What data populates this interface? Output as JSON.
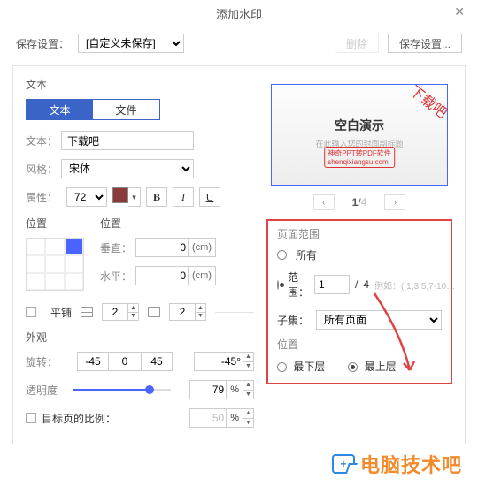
{
  "dialog": {
    "title": "添加水印",
    "close": "✕"
  },
  "saveRow": {
    "label": "保存设置：",
    "preset": "[自定义未保存]",
    "delete": "删除",
    "saveAs": "保存设置..."
  },
  "text": {
    "section": "文本",
    "tabs": {
      "text": "文本",
      "file": "文件"
    },
    "labels": {
      "text": "文本：",
      "style": "风格：",
      "attr": "属性："
    },
    "textValue": "下载吧",
    "styleValue": "宋体",
    "fontSize": "72"
  },
  "fmt": {
    "b": "B",
    "i": "I",
    "u": "U"
  },
  "position": {
    "title": "位置",
    "subTitle": "位置",
    "vert": "垂直：",
    "horiz": "水平：",
    "vertVal": "0",
    "horizVal": "0",
    "unit": "(cm)"
  },
  "tile": {
    "label": "平铺",
    "val1": "2",
    "val2": "2"
  },
  "appearance": {
    "title": "外观",
    "rotate": "旋转：",
    "rotVals": {
      "a": "-45",
      "b": "0",
      "c": "45"
    },
    "rotSel": "-45°",
    "opacity": "透明度",
    "opacityVal": "79",
    "target": "目标页的比例：",
    "targetVal": "50",
    "pct": "%"
  },
  "preview": {
    "corner": "下载吧",
    "title": "空白演示",
    "sub": "在此输入您的封面副标题",
    "stampL1": "神奇PPT转PDF软件",
    "stampL2": "shenqixiangsu.com"
  },
  "pager": {
    "prev": "‹",
    "next": "›",
    "page": "1",
    "sep": "/",
    "total": "4"
  },
  "range": {
    "title": "页面范围",
    "all": "所有",
    "range": "范围：",
    "from": "1",
    "slash": "/",
    "total": "4",
    "eg": "例如：( 1,3,5,7-10…",
    "subset": "子集：",
    "subsetVal": "所有页面",
    "posTitle": "位置",
    "bottom": "最下层",
    "top": "最上层"
  },
  "brand": {
    "icon": "+",
    "text": "电脑技术吧"
  }
}
